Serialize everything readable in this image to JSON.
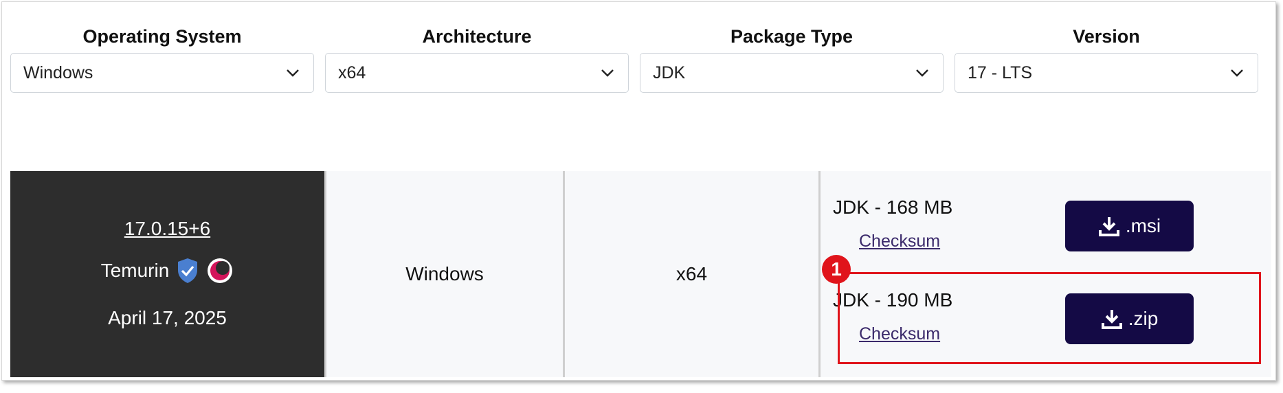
{
  "filters": [
    {
      "label": "Operating System",
      "value": "Windows"
    },
    {
      "label": "Architecture",
      "value": "x64"
    },
    {
      "label": "Package Type",
      "value": "JDK"
    },
    {
      "label": "Version",
      "value": "17 - LTS"
    }
  ],
  "release": {
    "version": "17.0.15+6",
    "vendor": "Temurin",
    "date": "April 17, 2025",
    "os": "Windows",
    "arch": "x64"
  },
  "packages": [
    {
      "size_label": "JDK - 168 MB",
      "checksum_label": "Checksum",
      "button_label": ".msi"
    },
    {
      "size_label": "JDK - 190 MB",
      "checksum_label": "Checksum",
      "button_label": ".zip"
    }
  ],
  "annotation": {
    "number": "1",
    "color": "#e0141b"
  },
  "colors": {
    "button_bg": "#140a45",
    "release_cell_bg": "#2d2d2d"
  }
}
